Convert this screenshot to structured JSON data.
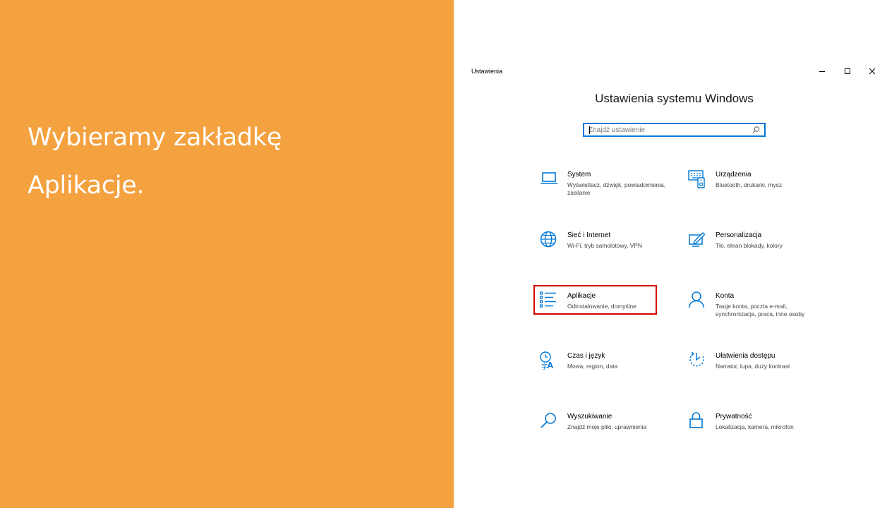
{
  "slide": {
    "line1": "Wybieramy zakładkę",
    "line2": "Aplikacje."
  },
  "window": {
    "title": "Ustawienia",
    "main_title": "Ustawienia systemu Windows",
    "search": {
      "placeholder": "Znajdź ustawienie"
    }
  },
  "tiles": [
    {
      "title": "System",
      "desc": "Wyświetlacz, dźwięk, powiadomienia, zasilanie",
      "icon": "laptop-icon"
    },
    {
      "title": "Urządzenia",
      "desc": "Bluetooth, drukarki, mysz",
      "icon": "devices-icon"
    },
    {
      "title": "Sieć i Internet",
      "desc": "Wi-Fi, tryb samolotowy, VPN",
      "icon": "globe-icon"
    },
    {
      "title": "Personalizacja",
      "desc": "Tło, ekran blokady, kolory",
      "icon": "personalization-icon"
    },
    {
      "title": "Aplikacje",
      "desc": "Odinstalowanie, domyślne",
      "icon": "apps-list-icon"
    },
    {
      "title": "Konta",
      "desc": "Twoje konta, poczta e-mail, synchronizacja, praca, inne osoby",
      "icon": "person-icon"
    },
    {
      "title": "Czas i język",
      "desc": "Mowa, region, data",
      "icon": "time-language-icon"
    },
    {
      "title": "Ułatwienia dostępu",
      "desc": "Narrator, lupa, duży kontrast",
      "icon": "ease-of-access-icon"
    },
    {
      "title": "Wyszukiwanie",
      "desc": "Znajdź moje pliki, uprawnienia",
      "icon": "search-icon"
    },
    {
      "title": "Prywatność",
      "desc": "Lokalizacja, kamera, mikrofon",
      "icon": "lock-icon"
    }
  ],
  "colors": {
    "accent": "#0078D7",
    "slide_background": "#F4A13F",
    "highlight": "#D90000"
  }
}
